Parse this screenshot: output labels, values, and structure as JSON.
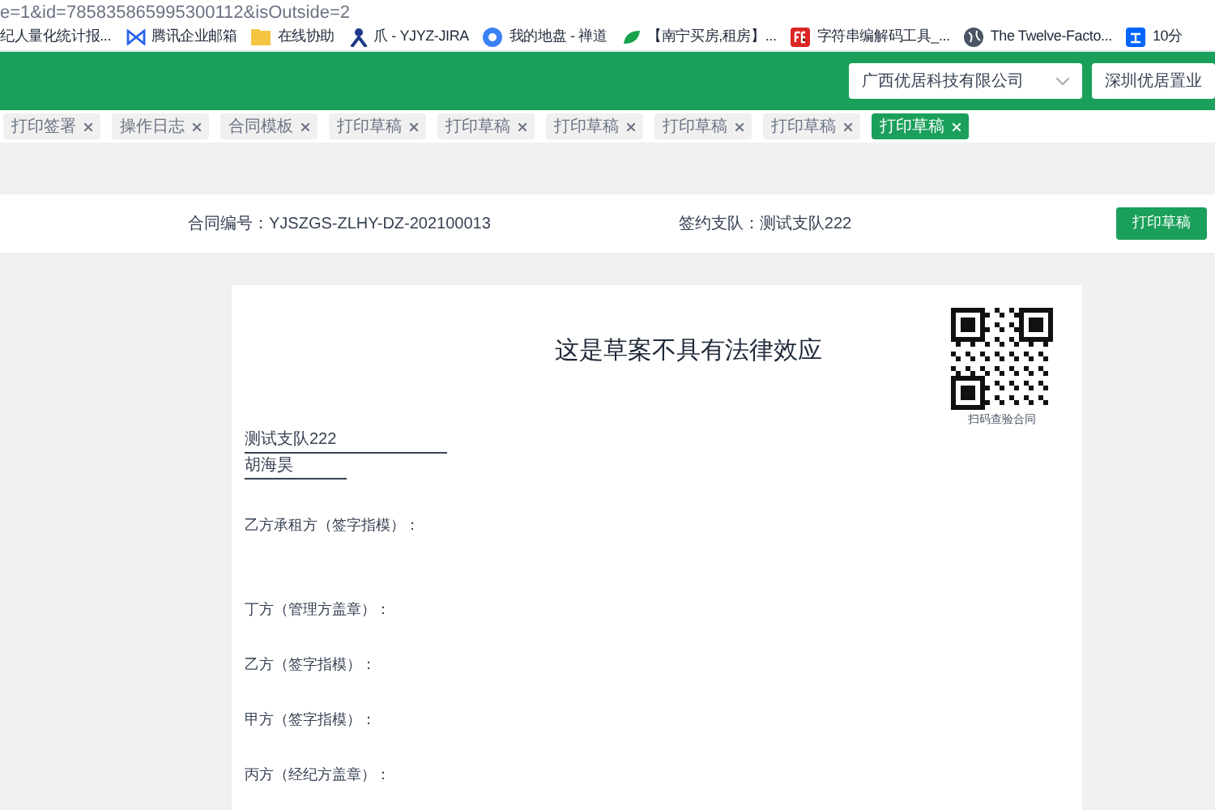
{
  "address_bar": {
    "url": "e=1&id=785835865995300112&isOutside=2"
  },
  "bookmarks": [
    {
      "label": "纪人量化统计报...",
      "kind": "none"
    },
    {
      "label": "腾讯企业邮箱",
      "kind": "mail"
    },
    {
      "label": "在线协助",
      "kind": "folder"
    },
    {
      "label": "爪 - YJYZ-JIRA",
      "kind": "jira"
    },
    {
      "label": "我的地盘 - 禅道",
      "kind": "zentao"
    },
    {
      "label": "【南宁买房,租房】...",
      "kind": "leaf"
    },
    {
      "label": "字符串编解码工具_...",
      "kind": "fe"
    },
    {
      "label": "The Twelve-Facto...",
      "kind": "globe"
    },
    {
      "label": "10分",
      "kind": "zhi"
    }
  ],
  "header": {
    "company_selects": [
      "广西优居科技有限公司",
      "深圳优居置业"
    ]
  },
  "tabs": [
    {
      "label": "打印签署",
      "selected": false
    },
    {
      "label": "操作日志",
      "selected": false
    },
    {
      "label": "合同模板",
      "selected": false
    },
    {
      "label": "打印草稿",
      "selected": false
    },
    {
      "label": "打印草稿",
      "selected": false
    },
    {
      "label": "打印草稿",
      "selected": false
    },
    {
      "label": "打印草稿",
      "selected": false
    },
    {
      "label": "打印草稿",
      "selected": false
    },
    {
      "label": "打印草稿",
      "selected": true
    }
  ],
  "info_bar": {
    "contract_no": "合同编号：YJSZGS-ZLHY-DZ-202100013",
    "team": "签约支队：测试支队222",
    "print_button": "打印草稿"
  },
  "document": {
    "title": "这是草案不具有法律效应",
    "qr_caption": "扫码查验合同",
    "names": [
      "测试支队222",
      "胡海昊"
    ],
    "signature_lines": [
      {
        "label": "乙方承租方（签字指模）："
      },
      {
        "label": "丁方（管理方盖章）："
      },
      {
        "label": "乙方（签字指模）："
      },
      {
        "label": "甲方（签字指模）："
      },
      {
        "label": "丙方（经纪方盖章）："
      }
    ]
  }
}
